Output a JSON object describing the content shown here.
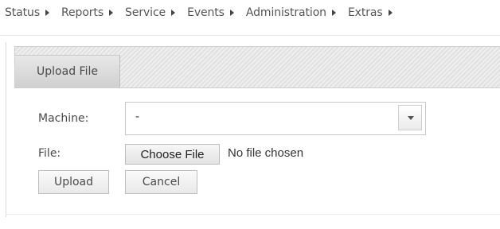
{
  "nav": {
    "items": [
      {
        "label": "Status"
      },
      {
        "label": "Reports"
      },
      {
        "label": "Service"
      },
      {
        "label": "Events"
      },
      {
        "label": "Administration"
      },
      {
        "label": "Extras"
      }
    ]
  },
  "panel": {
    "tab_label": "Upload File"
  },
  "form": {
    "machine_label": "Machine:",
    "machine_value": "-",
    "file_label": "File:",
    "choose_file_label": "Choose File",
    "no_file_text": "No file chosen",
    "upload_label": "Upload",
    "cancel_label": "Cancel"
  },
  "icons": {
    "nav_arrow": "caret-right-icon",
    "dropdown": "caret-down-icon"
  }
}
